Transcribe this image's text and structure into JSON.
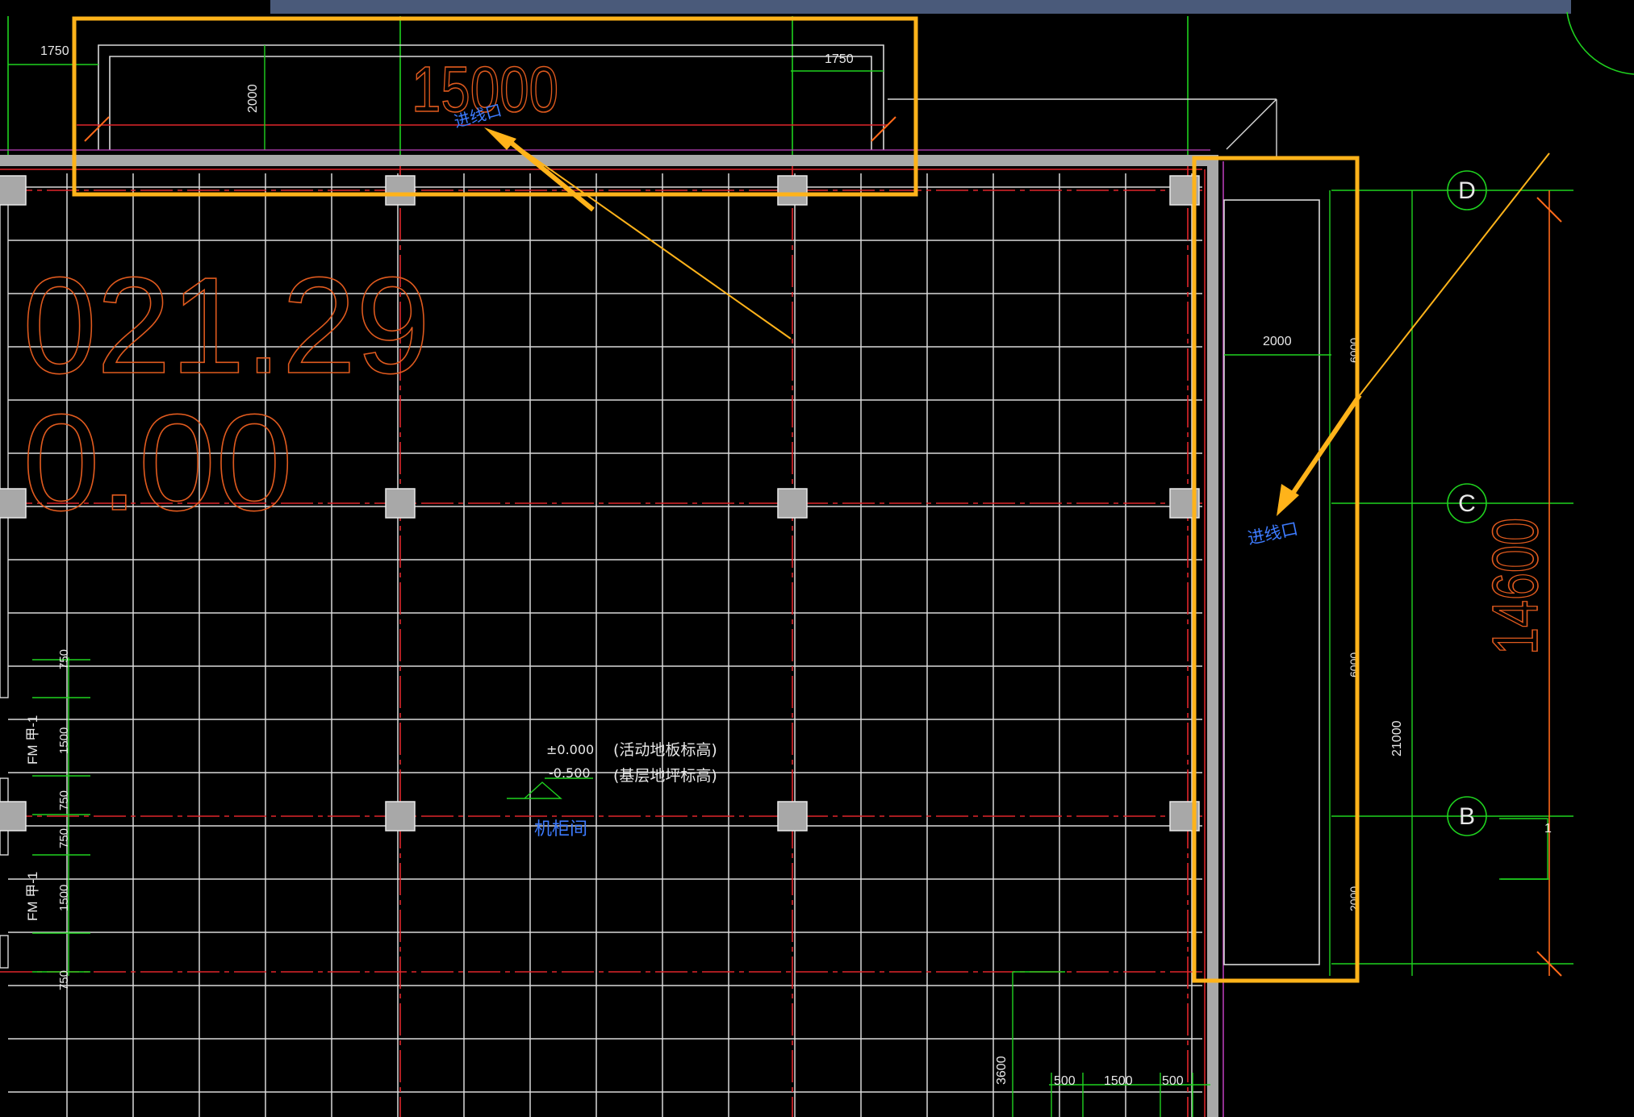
{
  "colors": {
    "background": "#000000",
    "grid_white": "#d9d9d9",
    "axis_red": "#e0262a",
    "wall_gray": "#a8a8a8",
    "dim_green": "#1fd21f",
    "text_blue": "#3d7bff",
    "orange_text": "#e05a1e",
    "highlight_yellow": "#ffb31a",
    "magenta": "#c040c0",
    "top_bar": "#4a5a7a"
  },
  "top_room": {
    "dim_left": "1750",
    "dim_right": "1750",
    "dim_height": "2000",
    "big_length": "15000",
    "entry_label": "进线口"
  },
  "right_room": {
    "dim_width": "2000",
    "seg_top": "6000",
    "seg_mid": "6000",
    "seg_bottom": "2000",
    "total": "21000",
    "big_length": "14600",
    "entry_label": "进线口"
  },
  "axis_bubbles": [
    "D",
    "C",
    "B"
  ],
  "left_big_text": {
    "line1": "021.29",
    "line2": "0.00"
  },
  "elevation": {
    "value1": "±0.000",
    "note1": "(活动地板标高)",
    "value2": "-0.500",
    "note2": "(基层地坪标高)",
    "room_name": "机柜间"
  },
  "left_dims": [
    "750",
    "1500",
    "750",
    "750",
    "1500",
    "750"
  ],
  "door_labels": [
    "FM 甲-1",
    "FM 甲-1"
  ],
  "bottom_dims": {
    "vertical": "3600",
    "a": "500",
    "b": "1500",
    "c": "500"
  },
  "marker_right": "1"
}
